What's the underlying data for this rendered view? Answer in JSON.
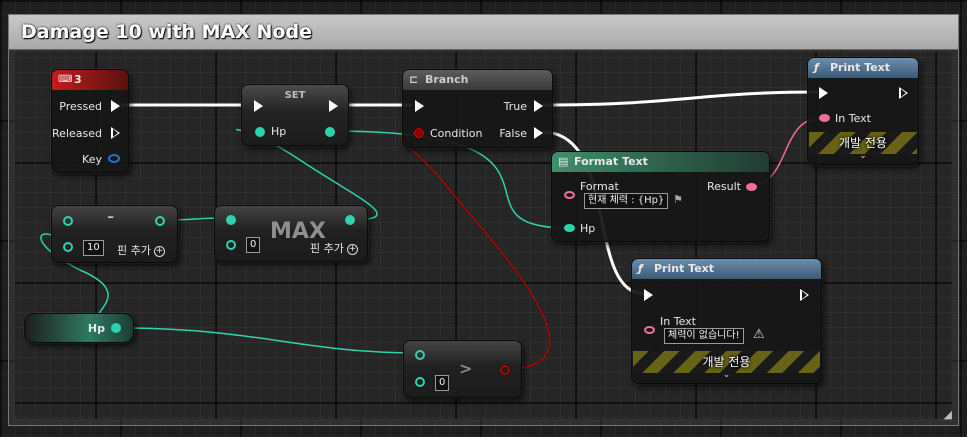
{
  "comment": {
    "title": "Damage 10 with MAX Node"
  },
  "key_event": {
    "title": "3",
    "pressed": "Pressed",
    "released": "Released",
    "key": "Key"
  },
  "set_node": {
    "title": "SET",
    "var": "Hp"
  },
  "branch": {
    "title": "Branch",
    "condition": "Condition",
    "true_label": "True",
    "false_label": "False"
  },
  "print_text_top": {
    "title": "Print Text",
    "in_text": "In Text",
    "dev_only": "개발 전용"
  },
  "format_text": {
    "title": "Format Text",
    "format_label": "Format",
    "format_value": "현재 체력 : {Hp}",
    "result": "Result",
    "hp": "Hp"
  },
  "subtract": {
    "title": "-",
    "value": "10",
    "add_pin": "핀 추가"
  },
  "max": {
    "title": "MAX",
    "value": "0",
    "add_pin": "핀 추가"
  },
  "get_hp": {
    "label": "Hp"
  },
  "greater": {
    "title": ">",
    "value": "0"
  },
  "print_text_bottom": {
    "title": "Print Text",
    "in_text": "In Text",
    "in_text_value": "체력이 없습니다!",
    "dev_only": "개발 전용"
  },
  "colors": {
    "exec": "#ffffff",
    "float_pin": "#2ed3ae",
    "bool_pin": "#a40000",
    "text_pin": "#ee6ea0",
    "func_header": "#5a7fa0",
    "event_header": "#b01e1e"
  }
}
